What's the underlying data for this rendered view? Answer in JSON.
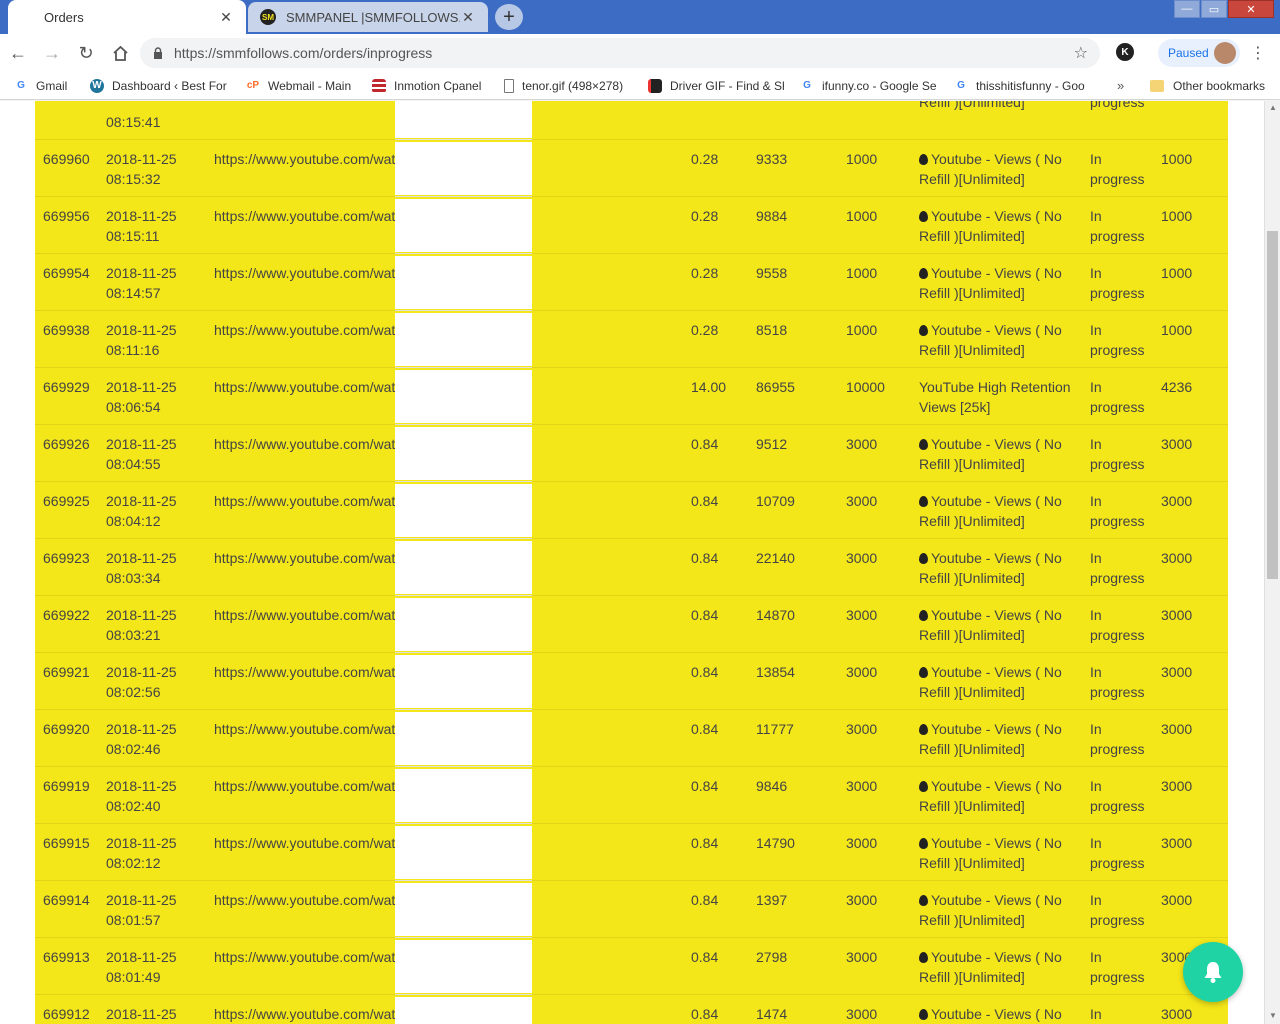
{
  "browser": {
    "tabs": [
      {
        "title": "Orders",
        "active": true
      },
      {
        "title": "SMMPANEL |SMMFOLLOWS.COM",
        "active": false
      }
    ],
    "url": "https://smmfollows.com/orders/inprogress",
    "profile_status": "Paused",
    "extension_letter": "K",
    "window_controls": {
      "minimize": "—",
      "maximize": "▭",
      "close": "✕"
    },
    "bookmarks": [
      {
        "label": "Gmail",
        "icon": "google-icon"
      },
      {
        "label": "Dashboard ‹ Best For",
        "icon": "wordpress-icon"
      },
      {
        "label": "Webmail - Main",
        "icon": "cpanel-icon"
      },
      {
        "label": "Inmotion Cpanel",
        "icon": "inmotion-icon"
      },
      {
        "label": "tenor.gif (498×278)",
        "icon": "page-icon"
      },
      {
        "label": "Driver GIF - Find & Sh",
        "icon": "tenor-icon"
      },
      {
        "label": "ifunny.co - Google Se",
        "icon": "google-icon"
      },
      {
        "label": "thisshitisfunny - Goo",
        "icon": "google-icon"
      }
    ],
    "bookmarks_overflow": "»",
    "other_bookmarks": "Other bookmarks"
  },
  "orders": {
    "rows": [
      {
        "id": "",
        "date": "",
        "time": "08:15:41",
        "link": "",
        "charge": "",
        "start": "",
        "qty": "",
        "service_icon": false,
        "service": "Refill )[Unlimited]",
        "status": "progress",
        "remains": ""
      },
      {
        "id": "669960",
        "date": "2018-11-25",
        "time": "08:15:32",
        "link": "https://www.youtube.com/watch",
        "charge": "0.28",
        "start": "9333",
        "qty": "1000",
        "service_icon": true,
        "service": "Youtube - Views ( No Refill )[Unlimited]",
        "status": "In progress",
        "remains": "1000"
      },
      {
        "id": "669956",
        "date": "2018-11-25",
        "time": "08:15:11",
        "link": "https://www.youtube.com/watch",
        "charge": "0.28",
        "start": "9884",
        "qty": "1000",
        "service_icon": true,
        "service": "Youtube - Views ( No Refill )[Unlimited]",
        "status": "In progress",
        "remains": "1000"
      },
      {
        "id": "669954",
        "date": "2018-11-25",
        "time": "08:14:57",
        "link": "https://www.youtube.com/watch",
        "charge": "0.28",
        "start": "9558",
        "qty": "1000",
        "service_icon": true,
        "service": "Youtube - Views ( No Refill )[Unlimited]",
        "status": "In progress",
        "remains": "1000"
      },
      {
        "id": "669938",
        "date": "2018-11-25",
        "time": "08:11:16",
        "link": "https://www.youtube.com/watch",
        "charge": "0.28",
        "start": "8518",
        "qty": "1000",
        "service_icon": true,
        "service": "Youtube - Views ( No Refill )[Unlimited]",
        "status": "In progress",
        "remains": "1000"
      },
      {
        "id": "669929",
        "date": "2018-11-25",
        "time": "08:06:54",
        "link": "https://www.youtube.com/watch",
        "charge": "14.00",
        "start": "86955",
        "qty": "10000",
        "service_icon": false,
        "service": "YouTube High Retention Views [25k]",
        "status": "In progress",
        "remains": "4236"
      },
      {
        "id": "669926",
        "date": "2018-11-25",
        "time": "08:04:55",
        "link": "https://www.youtube.com/watch",
        "charge": "0.84",
        "start": "9512",
        "qty": "3000",
        "service_icon": true,
        "service": "Youtube - Views ( No Refill )[Unlimited]",
        "status": "In progress",
        "remains": "3000"
      },
      {
        "id": "669925",
        "date": "2018-11-25",
        "time": "08:04:12",
        "link": "https://www.youtube.com/watch",
        "charge": "0.84",
        "start": "10709",
        "qty": "3000",
        "service_icon": true,
        "service": "Youtube - Views ( No Refill )[Unlimited]",
        "status": "In progress",
        "remains": "3000"
      },
      {
        "id": "669923",
        "date": "2018-11-25",
        "time": "08:03:34",
        "link": "https://www.youtube.com/watch",
        "charge": "0.84",
        "start": "22140",
        "qty": "3000",
        "service_icon": true,
        "service": "Youtube - Views ( No Refill )[Unlimited]",
        "status": "In progress",
        "remains": "3000"
      },
      {
        "id": "669922",
        "date": "2018-11-25",
        "time": "08:03:21",
        "link": "https://www.youtube.com/watch",
        "charge": "0.84",
        "start": "14870",
        "qty": "3000",
        "service_icon": true,
        "service": "Youtube - Views ( No Refill )[Unlimited]",
        "status": "In progress",
        "remains": "3000"
      },
      {
        "id": "669921",
        "date": "2018-11-25",
        "time": "08:02:56",
        "link": "https://www.youtube.com/watch",
        "charge": "0.84",
        "start": "13854",
        "qty": "3000",
        "service_icon": true,
        "service": "Youtube - Views ( No Refill )[Unlimited]",
        "status": "In progress",
        "remains": "3000"
      },
      {
        "id": "669920",
        "date": "2018-11-25",
        "time": "08:02:46",
        "link": "https://www.youtube.com/watch",
        "charge": "0.84",
        "start": "11777",
        "qty": "3000",
        "service_icon": true,
        "service": "Youtube - Views ( No Refill )[Unlimited]",
        "status": "In progress",
        "remains": "3000"
      },
      {
        "id": "669919",
        "date": "2018-11-25",
        "time": "08:02:40",
        "link": "https://www.youtube.com/watch",
        "charge": "0.84",
        "start": "9846",
        "qty": "3000",
        "service_icon": true,
        "service": "Youtube - Views ( No Refill )[Unlimited]",
        "status": "In progress",
        "remains": "3000"
      },
      {
        "id": "669915",
        "date": "2018-11-25",
        "time": "08:02:12",
        "link": "https://www.youtube.com/watch",
        "charge": "0.84",
        "start": "14790",
        "qty": "3000",
        "service_icon": true,
        "service": "Youtube - Views ( No Refill )[Unlimited]",
        "status": "In progress",
        "remains": "3000"
      },
      {
        "id": "669914",
        "date": "2018-11-25",
        "time": "08:01:57",
        "link": "https://www.youtube.com/watch",
        "charge": "0.84",
        "start": "1397",
        "qty": "3000",
        "service_icon": true,
        "service": "Youtube - Views ( No Refill )[Unlimited]",
        "status": "In progress",
        "remains": "3000"
      },
      {
        "id": "669913",
        "date": "2018-11-25",
        "time": "08:01:49",
        "link": "https://www.youtube.com/watch",
        "charge": "0.84",
        "start": "2798",
        "qty": "3000",
        "service_icon": true,
        "service": "Youtube - Views ( No Refill )[Unlimited]",
        "status": "In progress",
        "remains": "3000"
      },
      {
        "id": "669912",
        "date": "2018-11-25",
        "time": "",
        "link": "https://www.youtube.com/watch",
        "charge": "0.84",
        "start": "1474",
        "qty": "3000",
        "service_icon": true,
        "service": "Youtube - Views ( No",
        "status": "In",
        "remains": "3000"
      }
    ]
  },
  "colors": {
    "table_bg": "#f3e619",
    "tab_strip": "#3c6cc4",
    "fab": "#1fd3a5"
  }
}
